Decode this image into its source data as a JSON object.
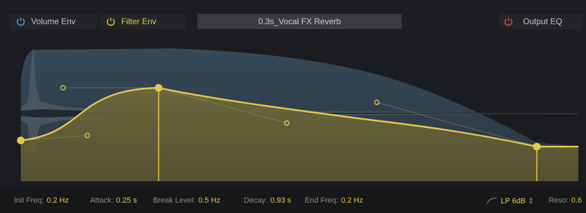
{
  "header": {
    "volume_env_label": "Volume Env",
    "filter_env_label": "Filter Env",
    "preset_name": "0.3s_Vocal FX Reverb",
    "output_eq_label": "Output EQ"
  },
  "params": {
    "init_freq_label": "Init Freq:",
    "init_freq_value": "0.2 Hz",
    "attack_label": "Attack:",
    "attack_value": "0.25 s",
    "break_level_label": "Break Level:",
    "break_level_value": "0.5 Hz",
    "decay_label": "Decay:",
    "decay_value": "0.93 s",
    "end_freq_label": "End Freq:",
    "end_freq_value": "0.2 Hz",
    "filter_type": "LP 6dB",
    "reso_label": "Reso:",
    "reso_value": "0.6"
  },
  "colors": {
    "accent_yellow": "#e7c84b",
    "power_off_red": "#d9534f",
    "power_blue": "#4aa3df"
  }
}
